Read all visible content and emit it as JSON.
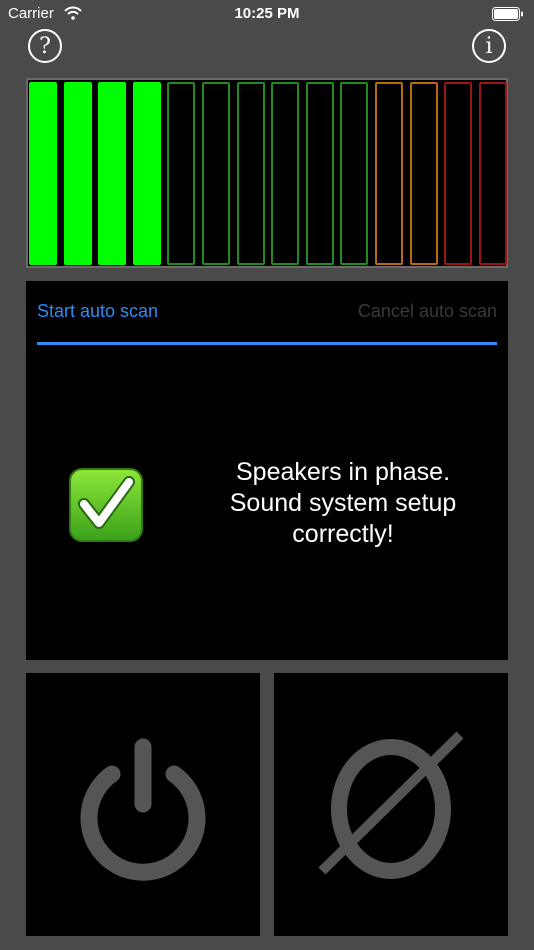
{
  "status_bar": {
    "carrier": "Carrier",
    "time": "10:25 PM",
    "wifi_icon": "wifi-icon",
    "battery_icon": "battery-icon"
  },
  "toolbar": {
    "help_label": "?",
    "info_label": "i"
  },
  "meter": {
    "total_bars": 14,
    "lit_bars": 4,
    "colors": {
      "lit": "#00ff00",
      "green_off": "#1f8a1f",
      "orange_off": "#b86a12",
      "red_off": "#9a1414"
    },
    "bar_zones": [
      "green",
      "green",
      "green",
      "green",
      "green",
      "green",
      "green",
      "green",
      "green",
      "green",
      "orange",
      "orange",
      "red",
      "red"
    ]
  },
  "scan": {
    "start_label": "Start auto scan",
    "cancel_label": "Cancel auto scan",
    "progress": 1.0,
    "accent_color": "#2d8cf5",
    "result_icon": "check-mark-icon",
    "result_message": "Speakers in phase.\nSound system setup\ncorrectly!"
  },
  "controls": {
    "power_icon": "power-icon",
    "phase_icon": "phase-invert-icon"
  }
}
